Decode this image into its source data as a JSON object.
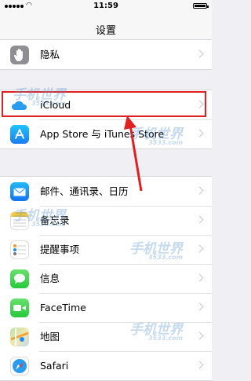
{
  "status_bar": {
    "time": "11:59"
  },
  "nav": {
    "title": "设置"
  },
  "rows": {
    "privacy": {
      "label": "隐私"
    },
    "icloud": {
      "label": "iCloud"
    },
    "appstore": {
      "label": "App Store 与 iTunes Store"
    },
    "mail": {
      "label": "邮件、通讯录、日历"
    },
    "notes": {
      "label": "备忘录"
    },
    "reminders": {
      "label": "提醒事项"
    },
    "messages": {
      "label": "信息"
    },
    "facetime": {
      "label": "FaceTime"
    },
    "maps": {
      "label": "地图"
    },
    "safari": {
      "label": "Safari"
    }
  },
  "watermark": {
    "text": "手机世界",
    "sub": "3533.com"
  },
  "colors": {
    "highlight": "#e02020",
    "background": "#efeff4"
  }
}
